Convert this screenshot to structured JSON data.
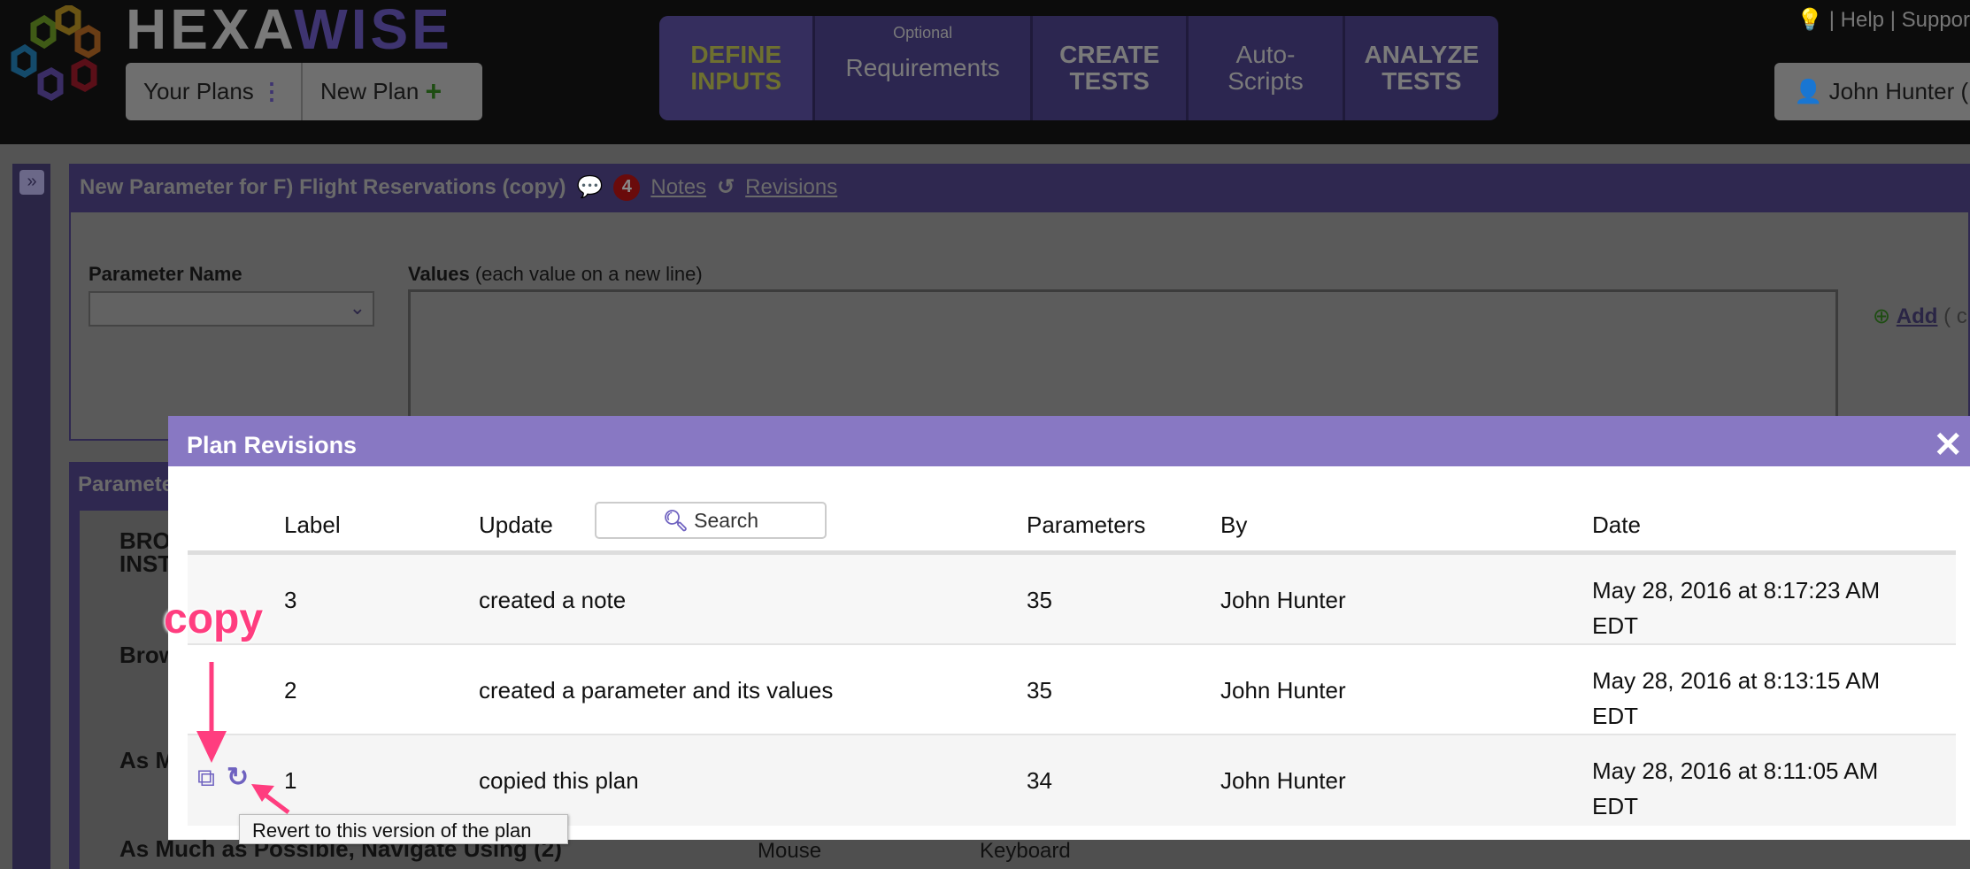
{
  "header": {
    "brand_a": "HEXA",
    "brand_b": "WISE",
    "your_plans": "Your Plans",
    "new_plan": "New Plan",
    "steps": [
      {
        "line1": "DEFINE",
        "line2": "INPUTS"
      },
      {
        "optional": "Optional",
        "line1": "Requirements",
        "line2": ""
      },
      {
        "line1": "CREATE",
        "line2": "TESTS"
      },
      {
        "line1": "Auto-",
        "line2": "Scripts"
      },
      {
        "line1": "ANALYZE",
        "line2": "TESTS"
      }
    ],
    "help": "Help",
    "support": "Suppor",
    "user": "John Hunter ("
  },
  "panel": {
    "title": "New Parameter for F) Flight Reservations (copy)",
    "notes_count": "4",
    "notes": "Notes",
    "revisions": "Revisions",
    "param_name_label": "Parameter Name",
    "values_label": "Values",
    "values_hint": "(each value on a new line)",
    "add": "Add",
    "add_rest": "( c"
  },
  "params": {
    "title": "Paramete",
    "rows": [
      "BRO",
      "INST",
      "Brow",
      "As M",
      "As Much as Possible, Navigate Using (2)"
    ],
    "mouse": "Mouse",
    "keyboard": "Keyboard"
  },
  "modal": {
    "title": "Plan Revisions",
    "close": "✕",
    "columns": {
      "label": "Label",
      "update": "Update",
      "search": "Search",
      "parameters": "Parameters",
      "by": "By",
      "date": "Date"
    },
    "rows": [
      {
        "label": "3",
        "update": "created a note",
        "parameters": "35",
        "by": "John Hunter",
        "date1": "May 28, 2016 at 8:17:23 AM",
        "date2": "EDT"
      },
      {
        "label": "2",
        "update": "created a parameter and its values",
        "parameters": "35",
        "by": "John Hunter",
        "date1": "May 28, 2016 at 8:13:15 AM",
        "date2": "EDT"
      },
      {
        "label": "1",
        "update": "copied this plan",
        "parameters": "34",
        "by": "John Hunter",
        "date1": "May 28, 2016 at 8:11:05 AM",
        "date2": "EDT"
      }
    ],
    "tooltip": "Revert to this version of the plan"
  },
  "annotation": {
    "copy": "copy",
    "color": "#ff3d7f"
  },
  "colors": {
    "modal_header": "#8878c3",
    "accent": "#6f62c0"
  }
}
